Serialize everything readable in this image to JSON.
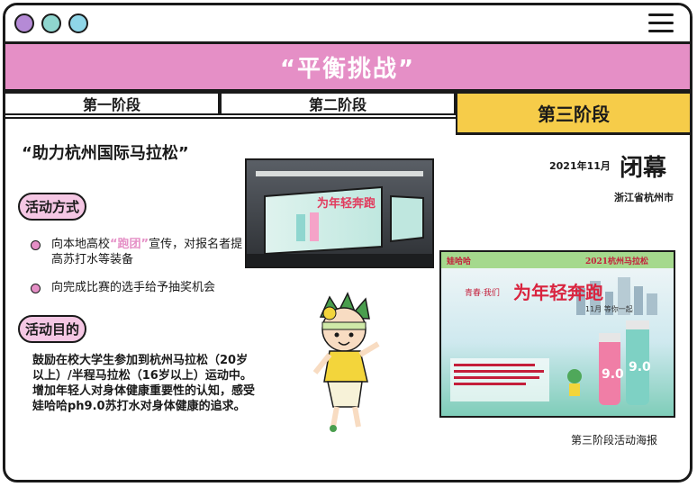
{
  "header": {
    "title": "“平衡挑战”"
  },
  "tabs": [
    {
      "label": "第一阶段"
    },
    {
      "label": "第二阶段"
    },
    {
      "label": "第三阶段"
    }
  ],
  "main": {
    "heading": "“助力杭州国际马拉松”",
    "section_method": "活动方式",
    "bullets": [
      {
        "pre": "向本地高校",
        "highlight": "“跑团”",
        "post": "宣传，对报名者提高苏打水等装备"
      },
      {
        "text": "向完成比赛的选手给予抽奖机会"
      }
    ],
    "section_goal": "活动目的",
    "goal_text": "鼓励在校大学生参加到杭州马拉松（20岁以上）/半程马拉松（16岁以上）运动中。增加年轻人对身体健康重要性的认知，感受娃哈哈ph9.0苏打水对身体健康的追求。"
  },
  "event": {
    "date": "2021年11月",
    "status": "闭幕",
    "location": "浙江省杭州市"
  },
  "photo": {
    "billboard_text": "为年轻奔跑"
  },
  "poster": {
    "brand": "娃哈哈",
    "event": "2021杭州马拉松",
    "slogan_small": "青春·我们",
    "slogan": "为年轻奔跑",
    "date": "11月 等你一起",
    "bottle_label": "9.0",
    "caption": "第三阶段活动海报"
  },
  "colors": {
    "pink": "#e58fc6",
    "yellow": "#f6cc49",
    "mint": "#8fd6cf",
    "purple": "#b58ad6"
  }
}
